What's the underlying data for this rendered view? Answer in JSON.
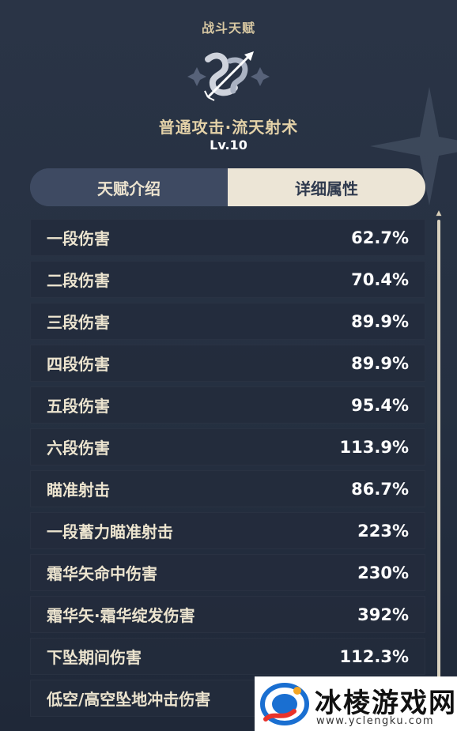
{
  "header": {
    "section_title": "战斗天赋",
    "skill_name": "普通攻击·流天射术",
    "skill_level": "Lv.10"
  },
  "tabs": [
    {
      "label": "天赋介绍",
      "active": false
    },
    {
      "label": "详细属性",
      "active": true
    }
  ],
  "attributes": [
    {
      "label": "一段伤害",
      "value": "62.7%"
    },
    {
      "label": "二段伤害",
      "value": "70.4%"
    },
    {
      "label": "三段伤害",
      "value": "89.9%"
    },
    {
      "label": "四段伤害",
      "value": "89.9%"
    },
    {
      "label": "五段伤害",
      "value": "95.4%"
    },
    {
      "label": "六段伤害",
      "value": "113.9%"
    },
    {
      "label": "瞄准射击",
      "value": "86.7%"
    },
    {
      "label": "一段蓄力瞄准射击",
      "value": "223%"
    },
    {
      "label": "霜华矢命中伤害",
      "value": "230%"
    },
    {
      "label": "霜华矢·霜华绽发伤害",
      "value": "392%"
    },
    {
      "label": "下坠期间伤害",
      "value": "112.3%"
    },
    {
      "label": "低空/高空坠地冲击伤害",
      "value": ""
    }
  ],
  "watermark": {
    "title": "冰棱游戏网",
    "url": "www.yclengku.com"
  },
  "icons": {
    "talent": "bow-arrow-icon",
    "scroll": "scroll-up-arrow-icon"
  },
  "colors": {
    "accent_gold": "#e4d2a8",
    "row_bg": "#232c3c",
    "active_tab": "#ece5d6"
  }
}
